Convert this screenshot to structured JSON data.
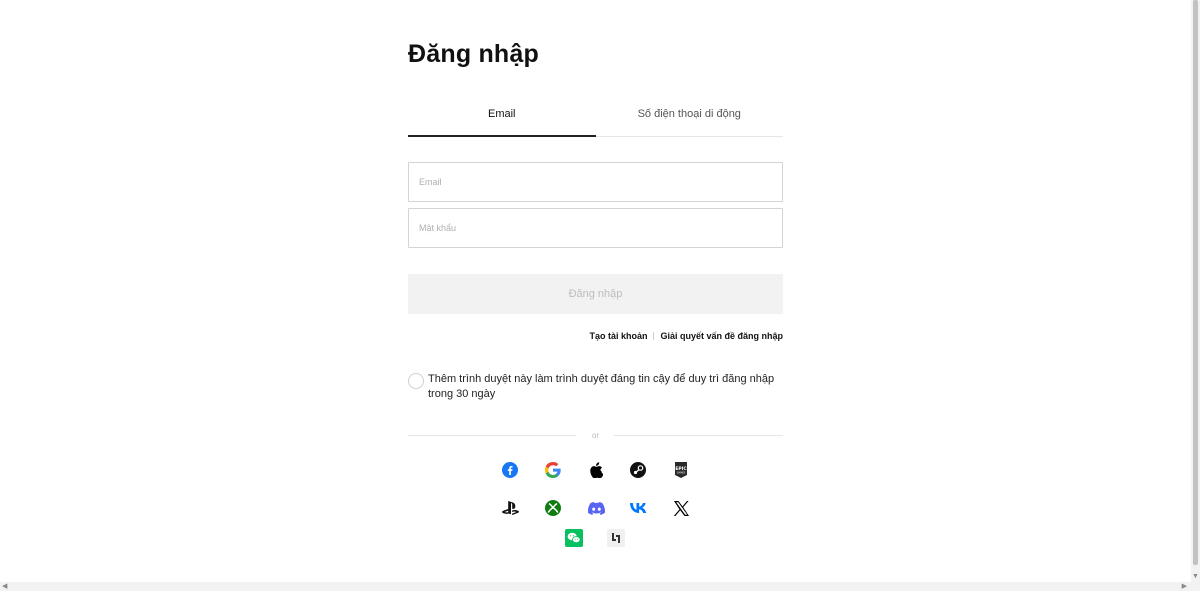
{
  "page_title": "Đăng nhập",
  "tabs": [
    {
      "label": "Email",
      "active": true
    },
    {
      "label": "Số điện thoại di động",
      "active": false
    }
  ],
  "form": {
    "email_placeholder": "Email",
    "email_value": "",
    "password_placeholder": "Mật khẩu",
    "password_value": "",
    "submit_label": "Đăng nhập"
  },
  "links": {
    "create_account": "Tạo tài khoản",
    "resolve_login": "Giải quyết vấn đề đăng nhập"
  },
  "trust_browser": {
    "label": "Thêm trình duyệt này làm trình duyệt đáng tin cậy để duy trì đăng nhập trong 30 ngày",
    "checked": false
  },
  "divider_text": "or",
  "social_providers": [
    {
      "name": "facebook-icon",
      "color": "#1877F2"
    },
    {
      "name": "google-icon",
      "color": "#4285F4"
    },
    {
      "name": "apple-icon",
      "color": "#000000"
    },
    {
      "name": "steam-icon",
      "color": "#111111"
    },
    {
      "name": "epic-games-icon",
      "color": "#2a2a2a"
    },
    {
      "name": "playstation-icon",
      "color": "#111111"
    },
    {
      "name": "xbox-icon",
      "color": "#107C10"
    },
    {
      "name": "discord-icon",
      "color": "#5865F2"
    },
    {
      "name": "vk-icon",
      "color": "#0077FF"
    },
    {
      "name": "x-icon",
      "color": "#000000"
    },
    {
      "name": "wechat-icon",
      "color": "#07C160"
    },
    {
      "name": "other-login-icon",
      "color": "#333333"
    }
  ],
  "colors": {
    "primary_text": "#111111",
    "disabled_button_bg": "#f2f2f2",
    "disabled_button_text": "#bdbdbd",
    "border": "#d4d4d4"
  }
}
